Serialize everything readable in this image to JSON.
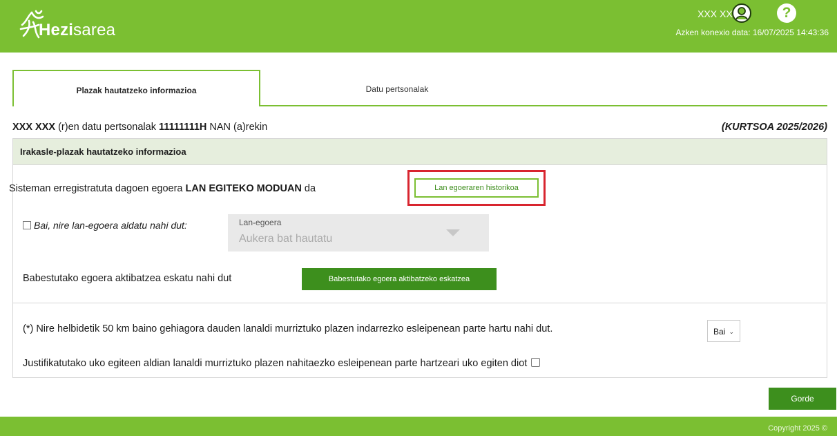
{
  "header": {
    "logo_text_bold": "Hezi",
    "logo_text_regular": "sarea",
    "user_name": "XXX XXX",
    "last_connection": "Azken konexio data: 16/07/2025 14:43:36",
    "help_symbol": "?",
    "icons": {
      "logo": "hezisarea-logo-icon",
      "user": "user-avatar-icon",
      "help": "help-icon"
    }
  },
  "tabs": [
    {
      "label": "Plazak hautatzeko informazioa",
      "active": true
    },
    {
      "label": "Datu pertsonalak",
      "active": false
    }
  ],
  "person": {
    "name": "XXX XXX",
    "text1": "(r)en datu pertsonalak",
    "id_number": "11111111H",
    "text2": "NAN (a)rekin",
    "course": "(KURTSOA 2025/2026)"
  },
  "panel": {
    "title": "Irakasle-plazak hautatzeko informazioa",
    "status_prefix": "Sisteman erregistratuta dagoen egoera",
    "status_value": "LAN EGITEKO MODUAN",
    "status_suffix": "da",
    "history_button": "Lan egoeraren historikoa",
    "change_checkbox_label": "Bai, nire lan-egoera aldatu nahi dut:",
    "work_status_select": {
      "label": "Lan-egoera",
      "placeholder": "Aukera bat hautatu"
    },
    "protected_text": "Babestutako egoera aktibatzea eskatu nahi dut",
    "protected_button": "Babestutako egoera aktibatzeko eskatzea",
    "forced_text": "(*) Nire helbidetik 50 km baino gehiagora dauden lanaldi murriztuko plazen indarrezko esleipenean parte hartu nahi dut.",
    "forced_select_value": "Bai",
    "renounce_text": "Justifikatutako uko egiteen aldian lanaldi murriztuko plazen nahitaezko esleipenean parte hartzeari uko egiten diot"
  },
  "actions": {
    "save_button": "Gorde"
  },
  "footer": {
    "copyright": "Copyright 2025 ©"
  },
  "colors": {
    "brand_green": "#7bbf32",
    "button_green": "#3d8f1d",
    "highlight_red": "#d8252f",
    "panel_header_bg": "#e6eedd"
  }
}
